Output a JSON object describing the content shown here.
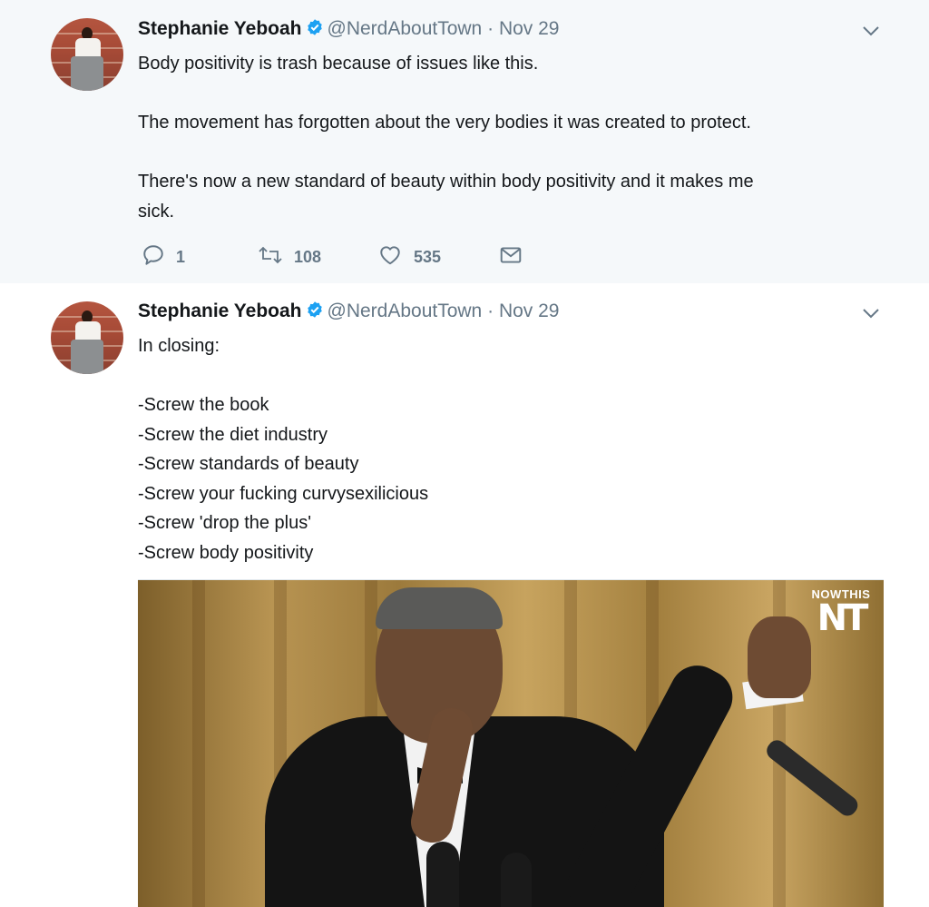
{
  "colors": {
    "verified": "#1da1f2",
    "meta_text": "#657786",
    "thread_line": "#ccd6dd",
    "highlight_bg": "#f5f8fa"
  },
  "tweets": [
    {
      "author_name": "Stephanie Yeboah",
      "handle": "@NerdAboutTown",
      "separator": "·",
      "date": "Nov 29",
      "body": "Body positivity is trash because of issues like this.\n\nThe movement has forgotten about the very bodies it was created to protect.\n\nThere's now a new standard of beauty within body positivity and it makes me\nsick.",
      "actions": {
        "reply_count": "1",
        "retweet_count": "108",
        "like_count": "535"
      },
      "icons": [
        "verified-badge-icon",
        "chevron-down-icon",
        "reply-icon",
        "retweet-icon",
        "like-icon",
        "direct-message-icon"
      ]
    },
    {
      "author_name": "Stephanie Yeboah",
      "handle": "@NerdAboutTown",
      "separator": "·",
      "date": "Nov 29",
      "body": "In closing:\n\n-Screw the book\n-Screw the diet industry\n-Screw standards of beauty\n-Screw your fucking curvysexilicious\n-Screw 'drop the plus'\n-Screw body positivity",
      "media": {
        "watermark_top": "NOWTHIS",
        "watermark_logo": "NT"
      },
      "icons": [
        "verified-badge-icon",
        "chevron-down-icon"
      ]
    }
  ]
}
